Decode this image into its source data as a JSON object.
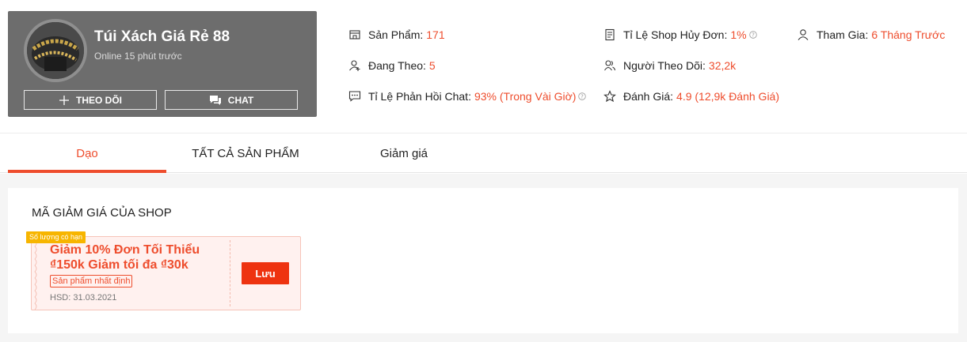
{
  "shop": {
    "name": "Túi Xách Giá Rẻ 88",
    "status": "Online 15 phút trước",
    "follow_label": "THEO DÕI",
    "chat_label": "CHAT",
    "follow_icon": "plus-icon",
    "chat_icon": "chat-bubbles-icon"
  },
  "stats": {
    "products": {
      "label": "Sản Phẩm:",
      "value": "171",
      "icon": "store-icon"
    },
    "following": {
      "label": "Đang Theo:",
      "value": "5",
      "icon": "user-plus-icon"
    },
    "chat_response": {
      "label": "Tỉ Lệ Phản Hồi Chat:",
      "value": "93% (Trong Vài Giờ)",
      "icon": "chat-icon"
    },
    "cancel_rate": {
      "label": "Tỉ Lệ Shop Hủy Đơn:",
      "value": "1%",
      "icon": "receipt-icon"
    },
    "followers": {
      "label": "Người Theo Dõi:",
      "value": "32,2k",
      "icon": "followers-icon"
    },
    "rating": {
      "label": "Đánh Giá:",
      "value": "4.9 (12,9k Đánh Giá)",
      "icon": "star-icon"
    },
    "joined": {
      "label": "Tham Gia:",
      "value": "6 Tháng Trước",
      "icon": "user-icon"
    }
  },
  "tabs": [
    {
      "label": "Dạo",
      "active": true
    },
    {
      "label": "TẤT CẢ SẢN PHẨM",
      "active": false
    },
    {
      "label": "Giảm giá",
      "active": false
    }
  ],
  "vouchers_section": {
    "title": "MÃ GIẢM GIÁ CỦA SHOP",
    "vouchers": [
      {
        "badge": "Số lượng có hạn",
        "line1": "Giảm 10% Đơn Tối Thiểu",
        "line2": "₫150k Giảm tối đa ₫30k",
        "tag": "Sản phẩm nhất định",
        "expiry": "HSD: 31.03.2021",
        "button": "Lưu"
      }
    ]
  },
  "colors": {
    "accent": "#ee4d2d",
    "card_bg": "#6d6d6d",
    "badge": "#f7b500",
    "voucher_bg": "#fff1ef"
  }
}
